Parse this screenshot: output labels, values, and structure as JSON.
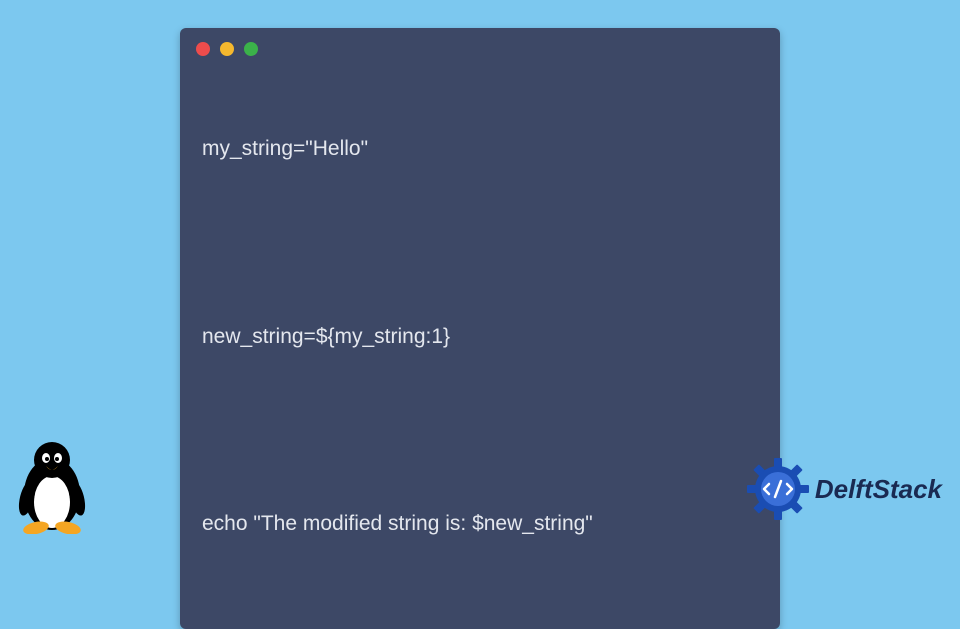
{
  "code": {
    "line1": "my_string=\"Hello\"",
    "line2": "new_string=${my_string:1}",
    "line3": "echo \"The modified string is: $new_string\""
  },
  "window": {
    "dot_red": "#ed4c4c",
    "dot_yellow": "#f5b82e",
    "dot_green": "#3bb24a"
  },
  "brand": {
    "name": "DelftStack"
  },
  "icons": {
    "tux": "tux-penguin-icon",
    "brand": "delftstack-gear-icon"
  }
}
